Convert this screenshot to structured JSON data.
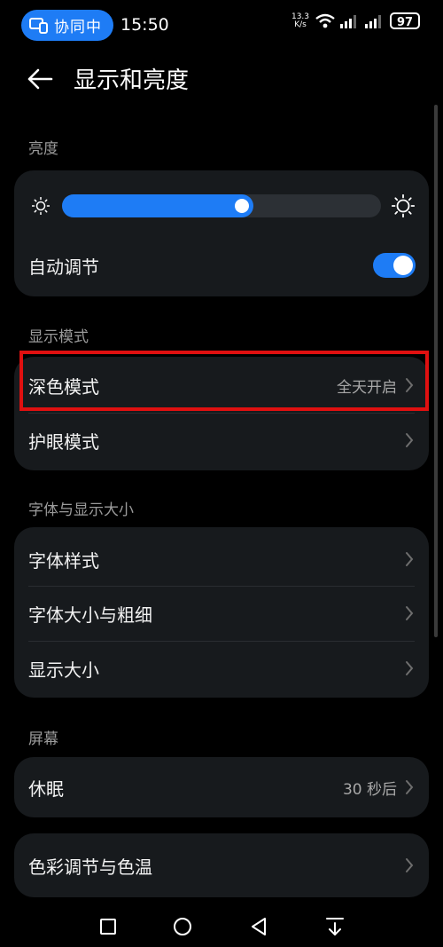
{
  "status_bar": {
    "collab_label": "协同中",
    "time": "15:50",
    "net_speed_value": "13.3",
    "net_speed_unit": "K/s",
    "battery": "97"
  },
  "header": {
    "title": "显示和亮度"
  },
  "brightness": {
    "section_label": "亮度",
    "level": 0.6,
    "auto_label": "自动调节",
    "auto_enabled": true
  },
  "display_mode": {
    "section_label": "显示模式",
    "items": [
      {
        "label": "深色模式",
        "value": "全天开启"
      },
      {
        "label": "护眼模式",
        "value": ""
      }
    ]
  },
  "font_size": {
    "section_label": "字体与显示大小",
    "items": [
      {
        "label": "字体样式"
      },
      {
        "label": "字体大小与粗细"
      },
      {
        "label": "显示大小"
      }
    ]
  },
  "screen": {
    "section_label": "屏幕",
    "sleep_label": "休眠",
    "sleep_value": "30 秒后",
    "color_label": "色彩调节与色温"
  },
  "colors": {
    "accent": "#1e7cf5",
    "card": "#171a1d",
    "highlight": "#e01010"
  }
}
